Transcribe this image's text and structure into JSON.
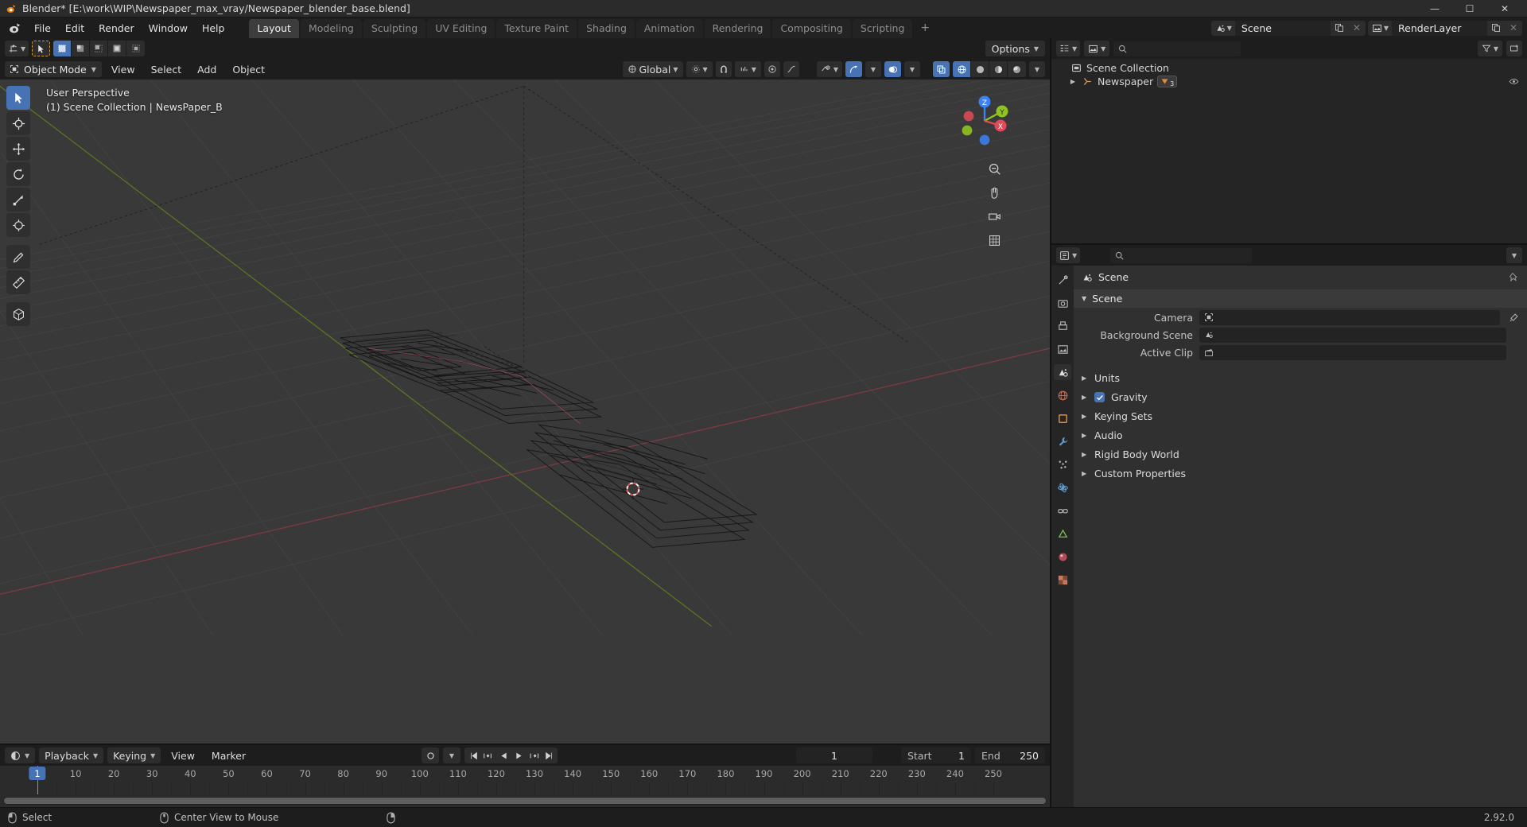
{
  "window": {
    "title": "Blender* [E:\\work\\WIP\\Newspaper_max_vray/Newspaper_blender_base.blend]",
    "app_icon": "blender-icon",
    "minimize": "—",
    "maximize": "☐",
    "close": "✕",
    "version": "2.92.0"
  },
  "topbar": {
    "logo": "blender-logo-icon",
    "menus": [
      "File",
      "Edit",
      "Render",
      "Window",
      "Help"
    ],
    "workspaces": [
      {
        "label": "Layout",
        "active": true
      },
      {
        "label": "Modeling",
        "active": false
      },
      {
        "label": "Sculpting",
        "active": false
      },
      {
        "label": "UV Editing",
        "active": false
      },
      {
        "label": "Texture Paint",
        "active": false
      },
      {
        "label": "Shading",
        "active": false
      },
      {
        "label": "Animation",
        "active": false
      },
      {
        "label": "Rendering",
        "active": false
      },
      {
        "label": "Compositing",
        "active": false
      },
      {
        "label": "Scripting",
        "active": false
      }
    ],
    "add_workspace": "+",
    "scene": {
      "icon": "scene-icon",
      "name": "Scene",
      "new_btn": "duplicate-icon",
      "unlink_btn": "✕"
    },
    "view_layer": {
      "icon": "view-layer-icon",
      "name": "RenderLayer",
      "new_btn": "duplicate-icon",
      "unlink_btn": "✕"
    }
  },
  "viewport": {
    "editor_type_icon": "editor-type-3dview-icon",
    "cursor_tool_icon": "select-box-tool-icon",
    "select_modes": [
      "select-set",
      "select-extend",
      "select-subtract",
      "select-invert",
      "select-intersect"
    ],
    "mode": "Object Mode",
    "mode_icon": "object-mode-icon",
    "menus": [
      "View",
      "Select",
      "Add",
      "Object"
    ],
    "transform_orientation": "Global",
    "snap_icon": "magnet-icon",
    "proportional_icon": "proportional-edit-icon",
    "falloff_icon": "falloff-curve-icon",
    "pivot_icon": "pivot-point-icon",
    "options_label": "Options",
    "visibility_icon": "object-visibility-icon",
    "gizmo_icon": "gizmo-icon",
    "overlays_icon": "overlays-icon",
    "xray_icon": "xray-toggle-icon",
    "shading_modes": [
      "wireframe-shading",
      "solid-shading",
      "material-preview-shading",
      "rendered-shading"
    ],
    "shading_active_index": 0,
    "info_lines": [
      "User Perspective",
      "(1) Scene Collection | NewsPaper_B"
    ],
    "toolbar_tools": [
      "tweak-select-tool-icon",
      "cursor-tool-icon",
      "move-tool-icon",
      "rotate-tool-icon",
      "scale-tool-icon",
      "transform-tool-icon",
      "annotate-tool-icon",
      "measure-tool-icon",
      "add-cube-tool-icon"
    ],
    "toolbar_active_index": 0,
    "gizmo_axes": [
      {
        "label": "Z",
        "color": "#3b82f6"
      },
      {
        "label": "Y",
        "color": "#8fc31f"
      },
      {
        "label": "X",
        "color": "#e04a5a"
      }
    ],
    "nav_buttons": [
      "zoom-icon",
      "pan-hand-icon",
      "camera-view-icon",
      "toggle-ortho-icon"
    ],
    "grid_color": "#4a4a4a",
    "background_color": "#393939",
    "x_axis_color": "#9c3b45",
    "y_axis_color": "#5b7a22",
    "object_cursor_label": "3d-cursor"
  },
  "timeline": {
    "editor_icon": "timeline-editor-icon",
    "menus": [
      "Playback",
      "Keying",
      "View",
      "Marker"
    ],
    "record_icon": "record-icon",
    "auto_key_icon": "auto-keying-icon",
    "transport": [
      "jump-start",
      "prev-keyframe",
      "play-reverse",
      "play",
      "next-keyframe",
      "jump-end"
    ],
    "current_frame": "1",
    "start_label": "Start",
    "start_value": "1",
    "end_label": "End",
    "end_value": "250",
    "ruler_ticks": [
      "10",
      "20",
      "30",
      "40",
      "50",
      "60",
      "70",
      "80",
      "90",
      "100",
      "110",
      "120",
      "130",
      "140",
      "150",
      "160",
      "170",
      "180",
      "190",
      "200",
      "210",
      "220",
      "230",
      "240",
      "250"
    ],
    "playhead_frame": "1"
  },
  "outliner": {
    "editor_icon": "outliner-editor-icon",
    "display_mode_icon": "view-layer-display-icon",
    "filter_icon": "filter-icon",
    "search_placeholder": "",
    "search_icon": "search-icon",
    "new_collection_icon": "new-collection-icon",
    "rows": [
      {
        "label": "Scene Collection",
        "icon": "scene-collection-icon",
        "indent": 0,
        "has_tri": false,
        "badge": null
      },
      {
        "label": "Newspaper",
        "icon": "armature-object-icon",
        "indent": 1,
        "has_tri": true,
        "badge": {
          "icon": "modifier-icon",
          "count": "3"
        }
      }
    ],
    "restrict_icons": [
      "hide-viewport-icon"
    ]
  },
  "properties": {
    "editor_icon": "properties-editor-icon",
    "search_icon": "search-icon",
    "search_placeholder": "",
    "filter_icon": "filter-dropdown-icon",
    "breadcrumb": {
      "icon": "scene-properties-icon",
      "label": "Scene",
      "pin_icon": "pin-icon"
    },
    "tabs": [
      {
        "name": "tool-properties-tab",
        "icon": "tool-icon",
        "active": false
      },
      {
        "name": "render-properties-tab",
        "icon": "camera-back-icon",
        "active": false
      },
      {
        "name": "output-properties-tab",
        "icon": "printer-icon",
        "active": false
      },
      {
        "name": "view-layer-properties-tab",
        "icon": "images-icon",
        "active": false
      },
      {
        "name": "scene-properties-tab",
        "icon": "cone-sphere-icon",
        "active": true
      },
      {
        "name": "world-properties-tab",
        "icon": "world-icon",
        "active": false
      },
      {
        "name": "object-properties-tab",
        "icon": "orange-square-icon",
        "active": false
      },
      {
        "name": "modifier-properties-tab",
        "icon": "wrench-icon",
        "active": false
      },
      {
        "name": "particles-properties-tab",
        "icon": "particles-icon",
        "active": false
      },
      {
        "name": "physics-properties-tab",
        "icon": "physics-icon",
        "active": false
      },
      {
        "name": "constraints-properties-tab",
        "icon": "constraint-icon",
        "active": false
      },
      {
        "name": "data-properties-tab",
        "icon": "green-triangle-icon",
        "active": false
      },
      {
        "name": "material-properties-tab",
        "icon": "material-sphere-icon",
        "active": false
      },
      {
        "name": "texture-properties-tab",
        "icon": "checker-texture-icon",
        "active": false
      }
    ],
    "panel": {
      "title": "Scene",
      "expanded": true
    },
    "fields": [
      {
        "label": "Camera",
        "value": "",
        "icon": "camera-data-icon",
        "has_eyedropper": true
      },
      {
        "label": "Background Scene",
        "value": "",
        "icon": "scene-icon",
        "has_eyedropper": false
      },
      {
        "label": "Active Clip",
        "value": "",
        "icon": "movie-clip-icon",
        "has_eyedropper": false
      }
    ],
    "sections": [
      {
        "label": "Units",
        "checkbox": null
      },
      {
        "label": "Gravity",
        "checkbox": true
      },
      {
        "label": "Keying Sets",
        "checkbox": null
      },
      {
        "label": "Audio",
        "checkbox": null
      },
      {
        "label": "Rigid Body World",
        "checkbox": null
      },
      {
        "label": "Custom Properties",
        "checkbox": null
      }
    ]
  },
  "statusbar": {
    "items": [
      {
        "icon": "mouse-left-icon",
        "label": "Select"
      },
      {
        "icon": "mouse-middle-icon",
        "label": "Center View to Mouse"
      },
      {
        "icon": "mouse-right-icon",
        "label": ""
      }
    ],
    "version": "2.92.0"
  },
  "colors": {
    "accent": "#4772b3",
    "header_bg": "#1d1d1d",
    "panel_bg": "#303030",
    "viewport_bg": "#393939",
    "outliner_bg": "#252525"
  }
}
